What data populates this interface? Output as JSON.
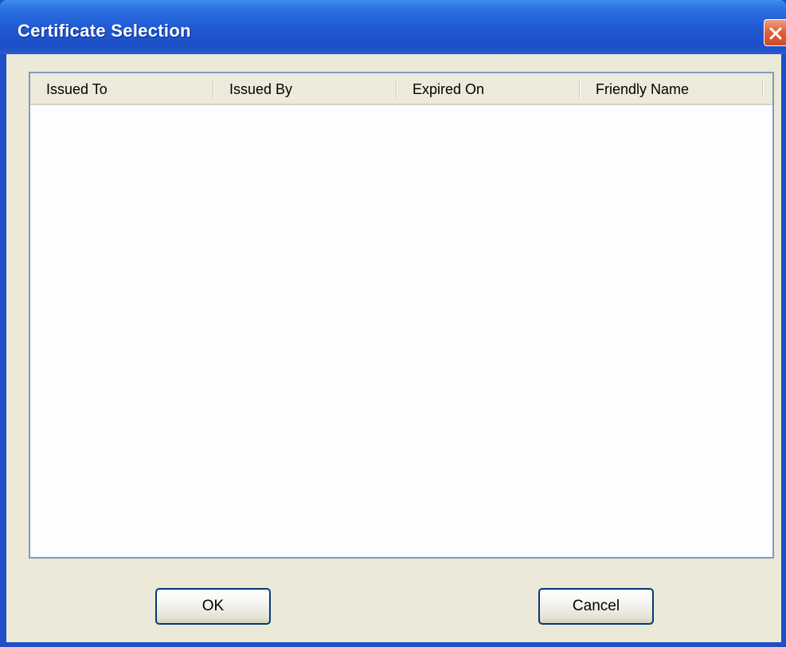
{
  "window": {
    "title": "Certificate Selection"
  },
  "list": {
    "columns": [
      "Issued To",
      "Issued By",
      "Expired On",
      "Friendly Name"
    ],
    "rows": []
  },
  "buttons": {
    "ok_label": "OK",
    "cancel_label": "Cancel"
  },
  "icons": {
    "close": "close-icon"
  },
  "colors": {
    "titlebar": "#1f58d4",
    "close_button": "#e0623e",
    "window_face": "#ece9d8",
    "list_border": "#7f9db9"
  }
}
